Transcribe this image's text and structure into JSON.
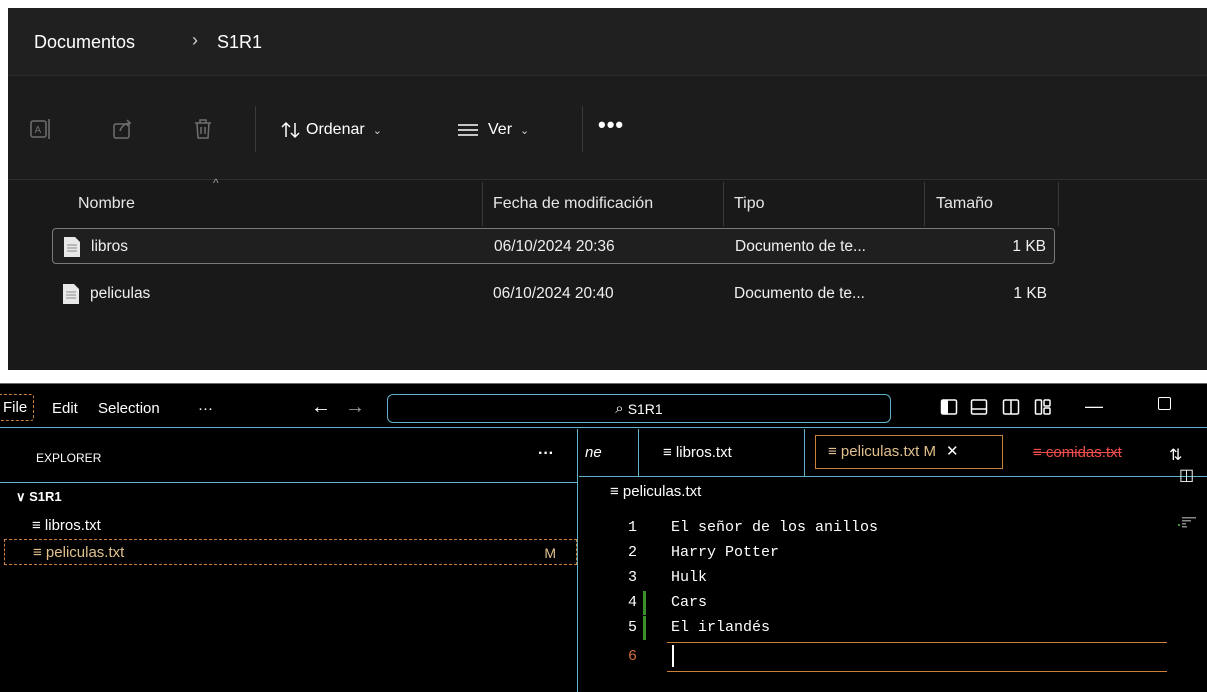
{
  "explorer": {
    "breadcrumb": [
      "Documentos",
      "S1R1"
    ],
    "breadcrumb_separator": "›",
    "toolbar": {
      "sort_label": "Ordenar",
      "view_label": "Ver",
      "more_label": "•••",
      "icons": [
        "rename-icon",
        "share-icon",
        "delete-icon",
        "sort-icon",
        "view-icon"
      ]
    },
    "columns": [
      "Nombre",
      "Fecha de modificación",
      "Tipo",
      "Tamaño"
    ],
    "files": [
      {
        "name": "libros",
        "date": "06/10/2024 20:36",
        "type": "Documento de te...",
        "size": "1 KB",
        "selected": true
      },
      {
        "name": "peliculas",
        "date": "06/10/2024 20:40",
        "type": "Documento de te...",
        "size": "1 KB",
        "selected": false
      }
    ]
  },
  "vscode": {
    "menu": [
      "File",
      "Edit",
      "Selection",
      "···"
    ],
    "search_text": "S1R1",
    "sidebar": {
      "title": "EXPLORER",
      "more": "···",
      "folder": "S1R1",
      "files": [
        {
          "name": "libros.txt",
          "badge": ""
        },
        {
          "name": "peliculas.txt",
          "badge": "M"
        }
      ]
    },
    "tabs": {
      "overflow": "ne",
      "items": [
        {
          "label": "libros.txt",
          "modified": ""
        },
        {
          "label": "peliculas.txt",
          "modified": "M"
        },
        {
          "label": "comidas.txt",
          "modified": ""
        }
      ]
    },
    "editor_breadcrumb": "peliculas.txt",
    "lines": [
      "El señor de los anillos",
      "Harry Potter",
      "Hulk",
      "Cars",
      "El irlandés",
      ""
    ],
    "line_numbers": [
      "1",
      "2",
      "3",
      "4",
      "5",
      "6"
    ],
    "colors": {
      "accent_border": "#5fb3c8",
      "modified": "#e2c08d",
      "deleted": "#f14c4c",
      "gutter_added": "#3c8f2c",
      "active_line_number": "#d7703c"
    }
  }
}
